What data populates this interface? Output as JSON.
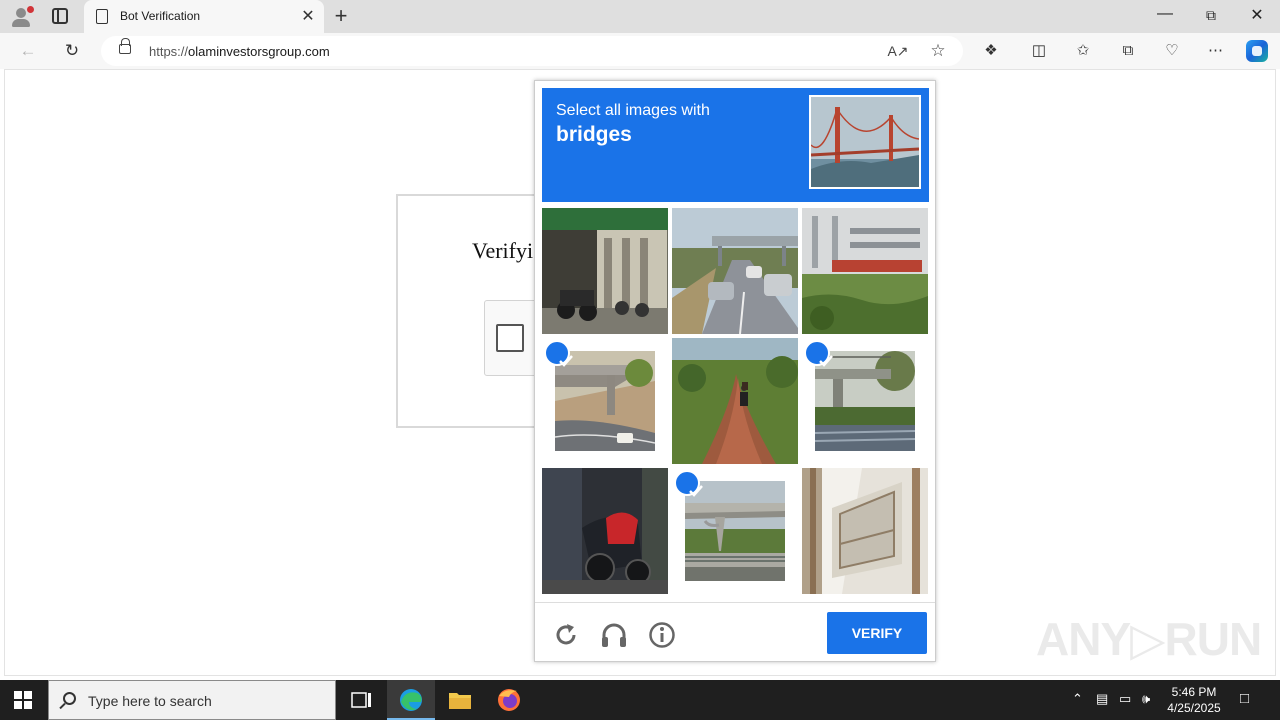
{
  "browser": {
    "tab_title": "Bot Verification",
    "url_prefix": "https://",
    "url_domain": "olaminvestorsgroup.com",
    "window_buttons": [
      "minimize",
      "restore",
      "close"
    ]
  },
  "page": {
    "heading": "Verifyi"
  },
  "captcha": {
    "instruction": "Select all images with",
    "target": "bridges",
    "tiles": [
      {
        "id": 1,
        "scene": "motorcycles-in-front-of-shop",
        "selected": false
      },
      {
        "id": 2,
        "scene": "road-with-cars-and-overpass",
        "selected": false
      },
      {
        "id": 3,
        "scene": "building-and-vegetation",
        "selected": false
      },
      {
        "id": 4,
        "scene": "overpass-bridge-over-road",
        "selected": true
      },
      {
        "id": 5,
        "scene": "dirt-road-with-motorbike",
        "selected": false
      },
      {
        "id": 6,
        "scene": "bridge-over-railway",
        "selected": true
      },
      {
        "id": 7,
        "scene": "red-motorcycle-parked",
        "selected": false
      },
      {
        "id": 8,
        "scene": "concrete-highway-bridge",
        "selected": true
      },
      {
        "id": 9,
        "scene": "building-wall-window",
        "selected": false
      }
    ],
    "verify_label": "VERIFY",
    "accent_color": "#1a73e8"
  },
  "watermark": {
    "part1": "ANY",
    "part2": "RUN"
  },
  "taskbar": {
    "search_placeholder": "Type here to search",
    "time": "5:46 PM",
    "date": "4/25/2025"
  }
}
